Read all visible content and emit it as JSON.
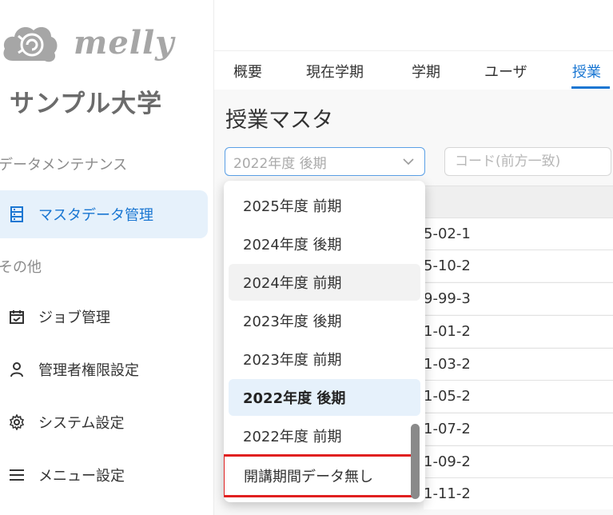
{
  "sidebar": {
    "logo_text": "melly",
    "university": "サンプル大学",
    "section_data": "データメンテナンス",
    "section_other": "その他",
    "items": [
      {
        "label": "マスタデータ管理",
        "icon": "database-icon"
      },
      {
        "label": "ジョブ管理",
        "icon": "calendar-check-icon"
      },
      {
        "label": "管理者権限設定",
        "icon": "person-icon"
      },
      {
        "label": "システム設定",
        "icon": "gear-icon"
      },
      {
        "label": "メニュー設定",
        "icon": "menu-icon"
      }
    ]
  },
  "tabs": [
    {
      "label": "概要"
    },
    {
      "label": "現在学期"
    },
    {
      "label": "学期"
    },
    {
      "label": "ユーザ"
    },
    {
      "label": "授業"
    }
  ],
  "page": {
    "title": "授業マスタ",
    "selected_term": "2022年度 後期",
    "code_placeholder": "コード(前方一致)"
  },
  "table": {
    "rows": [
      "5-02-1",
      "5-10-2",
      "9-99-3",
      "1-01-2",
      "1-03-2",
      "1-05-2",
      "1-07-2",
      "1-09-2",
      "1-11-2"
    ]
  },
  "dropdown": {
    "options": [
      {
        "label": "2025年度 前期"
      },
      {
        "label": "2024年度 後期"
      },
      {
        "label": "2024年度 前期"
      },
      {
        "label": "2023年度 後期"
      },
      {
        "label": "2023年度 前期"
      },
      {
        "label": "2022年度 後期"
      },
      {
        "label": "2022年度 前期"
      },
      {
        "label": "開講期間データ無し"
      }
    ]
  },
  "colors": {
    "accent": "#1976d2",
    "highlight": "#e02020"
  }
}
